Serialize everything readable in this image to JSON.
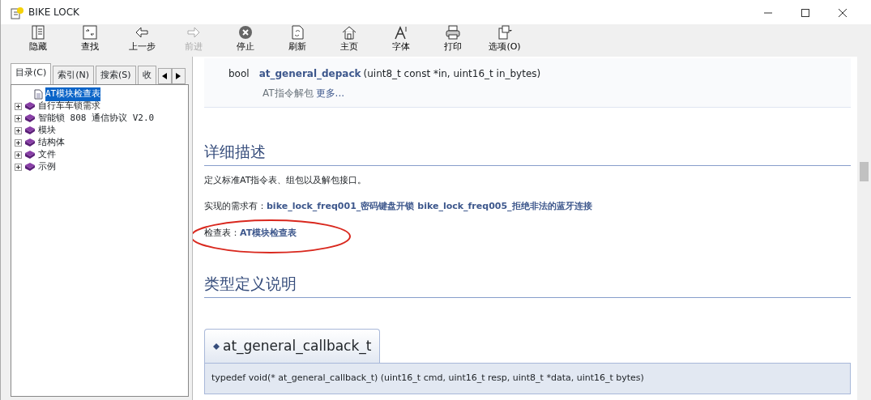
{
  "window": {
    "title": "BIKE LOCK"
  },
  "toolbar": [
    {
      "label": "隐藏",
      "disabled": false
    },
    {
      "label": "查找",
      "disabled": false
    },
    {
      "label": "上一步",
      "disabled": false
    },
    {
      "label": "前进",
      "disabled": true
    },
    {
      "label": "停止",
      "disabled": false
    },
    {
      "label": "刷新",
      "disabled": false
    },
    {
      "label": "主页",
      "disabled": false
    },
    {
      "label": "字体",
      "disabled": false
    },
    {
      "label": "打印",
      "disabled": false
    },
    {
      "label": "选项(O)",
      "disabled": false
    }
  ],
  "nav_tabs": [
    {
      "label": "目录(C)",
      "selected": true
    },
    {
      "label": "索引(N)",
      "selected": false
    },
    {
      "label": "搜索(S)",
      "selected": false
    },
    {
      "label": "收",
      "selected": false
    }
  ],
  "tree": [
    {
      "label": "AT模块检查表",
      "kind": "page",
      "selected": true
    },
    {
      "label": "自行车车锁需求",
      "kind": "book",
      "selected": false
    },
    {
      "label": "智能锁 808 通信协议 V2.0",
      "kind": "book",
      "selected": false
    },
    {
      "label": "模块",
      "kind": "book",
      "selected": false
    },
    {
      "label": "结构体",
      "kind": "book",
      "selected": false
    },
    {
      "label": "文件",
      "kind": "book",
      "selected": false
    },
    {
      "label": "示例",
      "kind": "book",
      "selected": false
    }
  ],
  "content": {
    "member": {
      "type": "bool",
      "name": "at_general_depack",
      "args": "(uint8_t const *in, uint16_t in_bytes)",
      "brief": "AT指令解包",
      "more": "更多..."
    },
    "detail_heading": "详细描述",
    "description": "定义标准AT指令表、组包以及解包接口。",
    "requirements_label": "实现的需求有：",
    "requirements": [
      "bike_lock_freq001_密码键盘开锁",
      "bike_lock_freq005_拒绝非法的蓝牙连接"
    ],
    "checklist_label": "检查表：",
    "checklist_link": "AT模块检查表",
    "typedef_heading": "类型定义说明",
    "typedef_name": "at_general_callback_t",
    "typedef_decl": "typedef void(* at_general_callback_t) (uint16_t cmd, uint16_t resp, uint8_t *data, uint16_t bytes)"
  }
}
